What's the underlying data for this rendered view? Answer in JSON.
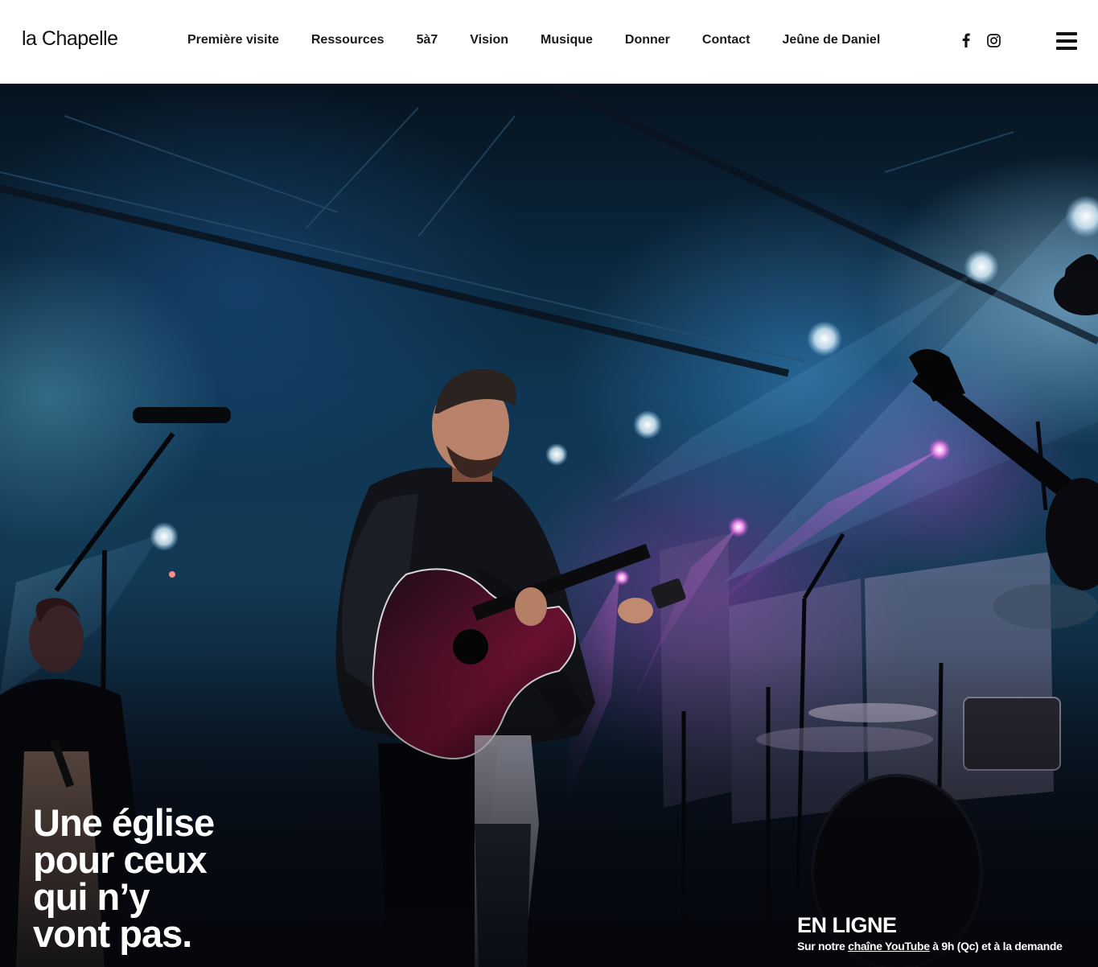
{
  "header": {
    "logo": "la Chapelle",
    "nav": [
      {
        "label": "Première visite"
      },
      {
        "label": "Ressources"
      },
      {
        "label": "5à7"
      },
      {
        "label": "Vision"
      },
      {
        "label": "Musique"
      },
      {
        "label": "Donner"
      },
      {
        "label": "Contact"
      },
      {
        "label": "Jeûne de Daniel"
      }
    ],
    "social": [
      "facebook-icon",
      "instagram-icon"
    ],
    "menu_icon": "hamburger-menu-icon"
  },
  "hero": {
    "headline_lines": [
      "Une église",
      "pour ceux",
      "qui n’y",
      "vont pas."
    ],
    "online": {
      "title": "EN LIGNE",
      "sub_prefix": "Sur notre ",
      "sub_link": "chaîne YouTube",
      "sub_suffix": " à 9h (Qc) et à la demande"
    }
  }
}
